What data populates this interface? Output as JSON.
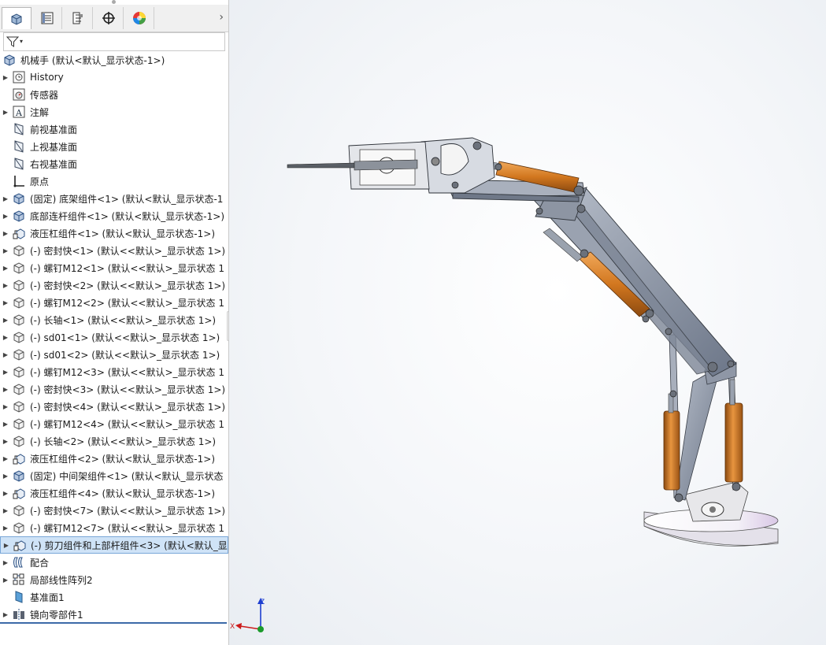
{
  "tabs": [
    {
      "name": "featuremanager-tab",
      "icon": "featuremanager-icon"
    },
    {
      "name": "propertymanager-tab",
      "icon": "propertymanager-icon"
    },
    {
      "name": "configurationmanager-tab",
      "icon": "configurationmanager-icon"
    },
    {
      "name": "dimxpert-tab",
      "icon": "crosshair-icon"
    },
    {
      "name": "appearance-tab",
      "icon": "appearance-icon"
    }
  ],
  "tab_more": "›",
  "tree": {
    "root": "机械手  (默认<默认_显示状态-1>)",
    "items": [
      {
        "label": "History",
        "icon": "history-icon",
        "expand": true
      },
      {
        "label": "传感器",
        "icon": "sensor-icon",
        "expand": false
      },
      {
        "label": "注解",
        "icon": "annotation-icon",
        "expand": true
      },
      {
        "label": "前视基准面",
        "icon": "plane-icon",
        "expand": false
      },
      {
        "label": "上视基准面",
        "icon": "plane-icon",
        "expand": false
      },
      {
        "label": "右视基准面",
        "icon": "plane-icon",
        "expand": false
      },
      {
        "label": "原点",
        "icon": "origin-icon",
        "expand": false
      },
      {
        "label": "(固定) 底架组件<1> (默认<默认_显示状态-1",
        "icon": "assembly-icon",
        "expand": true
      },
      {
        "label": "底部连杆组件<1> (默认<默认_显示状态-1>)",
        "icon": "assembly-icon",
        "expand": true
      },
      {
        "label": "液压杠组件<1> (默认<默认_显示状态-1>)",
        "icon": "flexible-assembly-icon",
        "expand": true
      },
      {
        "label": "(-) 密封快<1> (默认<<默认>_显示状态 1>)",
        "icon": "part-icon",
        "expand": true
      },
      {
        "label": "(-) 螺钉M12<1> (默认<<默认>_显示状态 1",
        "icon": "part-icon",
        "expand": true
      },
      {
        "label": "(-) 密封快<2> (默认<<默认>_显示状态 1>)",
        "icon": "part-icon",
        "expand": true
      },
      {
        "label": "(-) 螺钉M12<2> (默认<<默认>_显示状态 1",
        "icon": "part-icon",
        "expand": true
      },
      {
        "label": "(-) 长轴<1> (默认<<默认>_显示状态 1>)",
        "icon": "part-icon",
        "expand": true
      },
      {
        "label": "(-) sd01<1> (默认<<默认>_显示状态 1>)",
        "icon": "part-icon",
        "expand": true
      },
      {
        "label": "(-) sd01<2> (默认<<默认>_显示状态 1>)",
        "icon": "part-icon",
        "expand": true
      },
      {
        "label": "(-) 螺钉M12<3> (默认<<默认>_显示状态 1",
        "icon": "part-icon",
        "expand": true
      },
      {
        "label": "(-) 密封快<3> (默认<<默认>_显示状态 1>)",
        "icon": "part-icon",
        "expand": true
      },
      {
        "label": "(-) 密封快<4> (默认<<默认>_显示状态 1>)",
        "icon": "part-icon",
        "expand": true
      },
      {
        "label": "(-) 螺钉M12<4> (默认<<默认>_显示状态 1",
        "icon": "part-icon",
        "expand": true
      },
      {
        "label": "(-) 长轴<2> (默认<<默认>_显示状态 1>)",
        "icon": "part-icon",
        "expand": true
      },
      {
        "label": "液压杠组件<2> (默认<默认_显示状态-1>)",
        "icon": "flexible-assembly-icon",
        "expand": true
      },
      {
        "label": "(固定) 中间架组件<1> (默认<默认_显示状态",
        "icon": "assembly-icon",
        "expand": true
      },
      {
        "label": "液压杠组件<4> (默认<默认_显示状态-1>)",
        "icon": "flexible-assembly-icon",
        "expand": true
      },
      {
        "label": "(-) 密封快<7> (默认<<默认>_显示状态 1>)",
        "icon": "part-icon",
        "expand": true
      },
      {
        "label": "(-) 螺钉M12<7> (默认<<默认>_显示状态 1",
        "icon": "part-icon",
        "expand": true
      },
      {
        "label": "(-) 剪刀组件和上部杆组件<3> (默认<默认_显",
        "icon": "flexible-assembly-icon",
        "expand": true,
        "selected": true
      },
      {
        "label": "配合",
        "icon": "mates-icon",
        "expand": true
      },
      {
        "label": "局部线性阵列2",
        "icon": "linear-pattern-icon",
        "expand": true
      },
      {
        "label": "基准面1",
        "icon": "plane-blue-icon",
        "expand": false
      },
      {
        "label": "镜向零部件1",
        "icon": "mirror-component-icon",
        "expand": true
      }
    ]
  },
  "triad": {
    "x_label": "X",
    "y_label": "Y",
    "z_label": "Z"
  },
  "colors": {
    "hydraulic_cylinder": "#d2771f",
    "steel_link": "#7f8a9c",
    "base_disc": "#f0eef6",
    "selection": "#cfe3f7"
  }
}
